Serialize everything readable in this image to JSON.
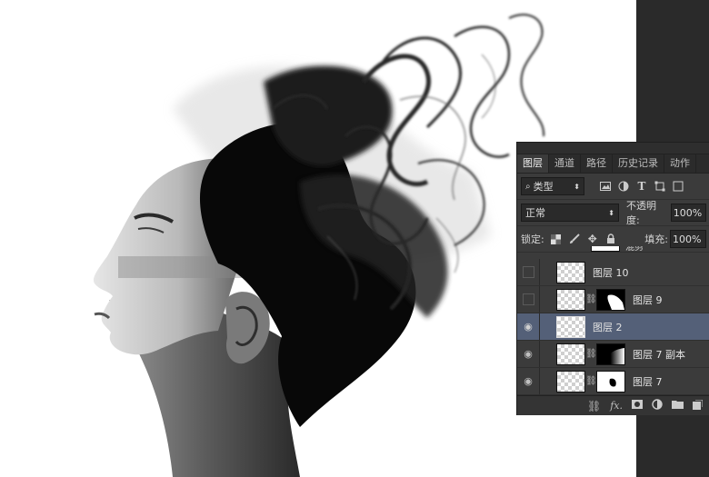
{
  "panel": {
    "tabs": [
      "图层",
      "通道",
      "路径",
      "历史记录",
      "动作"
    ],
    "filter_kind": "类型",
    "blend_mode": "正常",
    "opacity_label": "不透明度:",
    "opacity_value": "100%",
    "lock_label": "锁定:",
    "fill_label": "填充:",
    "fill_value": "100%",
    "partial_layer_name": "混剪",
    "layers": [
      {
        "name": "图层 10",
        "visible": false,
        "has_mask": false,
        "selected": false
      },
      {
        "name": "图层 9",
        "visible": false,
        "has_mask": true,
        "selected": false
      },
      {
        "name": "图层 2",
        "visible": true,
        "has_mask": false,
        "selected": true
      },
      {
        "name": "图层 7 副本",
        "visible": true,
        "has_mask": true,
        "selected": false
      },
      {
        "name": "图层 7",
        "visible": true,
        "has_mask": true,
        "selected": false
      }
    ],
    "bottom_icons": [
      "link-icon",
      "fx-icon",
      "mask-icon",
      "adjustment-icon",
      "folder-icon",
      "new-layer-icon"
    ],
    "fx_label": "fx."
  },
  "colors": {
    "panel_bg": "#3b3b3b",
    "selected_row": "#546078",
    "workspace_dark": "#2a2a2a"
  }
}
